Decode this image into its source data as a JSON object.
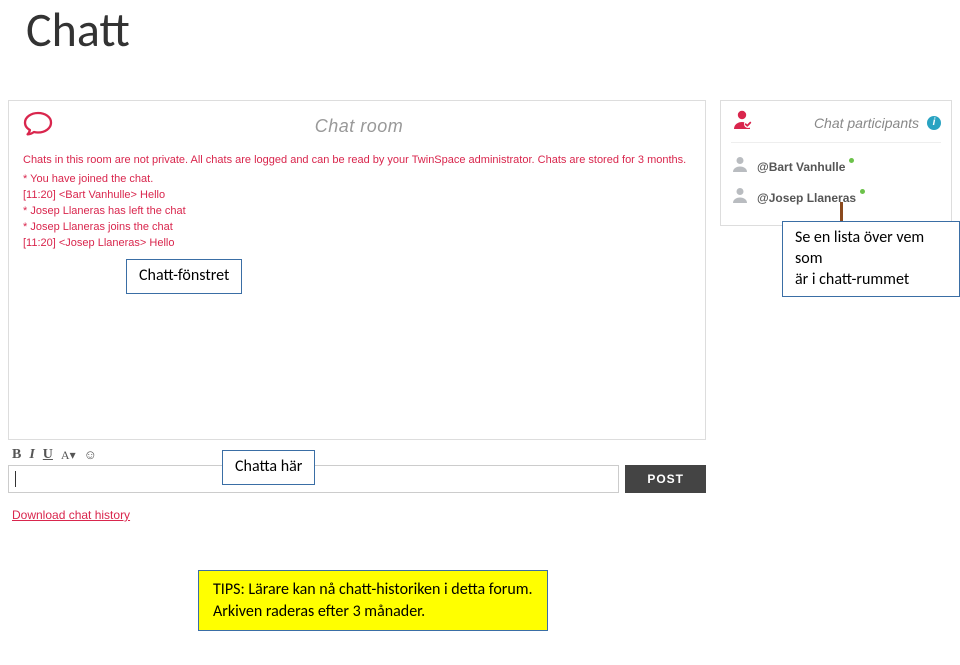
{
  "heading": "Chatt",
  "chat": {
    "title": "Chat room",
    "privacy": "Chats in this room are not private. All chats are logged and can be read by your TwinSpace administrator. Chats are stored for 3 months.",
    "log": [
      "* You have joined the chat.",
      "[11:20] <Bart Vanhulle> Hello",
      "* Josep Llaneras has left the chat",
      "* Josep Llaneras joins the chat",
      "[11:20] <Josep Llaneras> Hello"
    ]
  },
  "participants": {
    "title": "Chat participants",
    "info_glyph": "i",
    "list": [
      {
        "name": "@Bart Vanhulle"
      },
      {
        "name": "@Josep Llaneras"
      }
    ]
  },
  "toolbar": {
    "bold": "B",
    "italic": "I",
    "underline": "U",
    "font": "A▾",
    "emoji": "☺"
  },
  "compose": {
    "value": ""
  },
  "post_label": "POST",
  "download_label": "Download chat history",
  "callouts": {
    "c1": "Chatt-fönstret",
    "c2": "Se en lista över vem som\när i chatt-rummet",
    "c3": "Chatta här"
  },
  "tip": "TIPS: Lärare kan nå chatt-historiken i detta forum.\nArkiven raderas efter 3 månader."
}
